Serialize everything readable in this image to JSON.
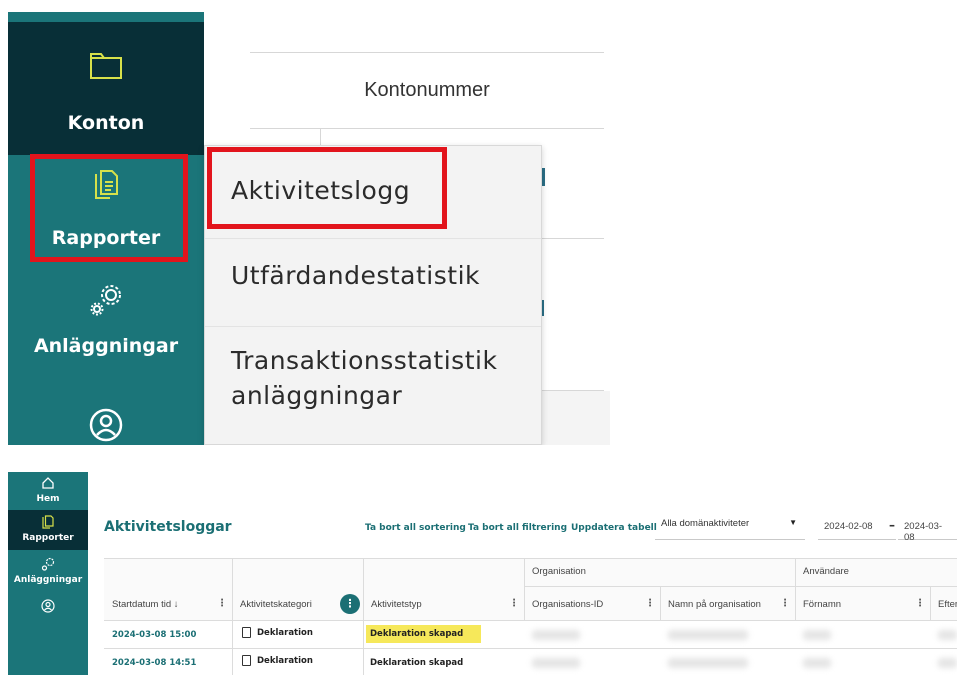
{
  "zoom": {
    "sidebar": {
      "konton_label": "Konton",
      "rapporter_label": "Rapporter",
      "anlaggningar_label": "Anläggningar"
    },
    "table": {
      "column_header": "Kontonummer"
    },
    "menu": {
      "items": [
        "Aktivitetslogg",
        "Utfärdandestatistik",
        "Transaktionsstatistik",
        "anläggningar"
      ]
    },
    "highlight_color": "#e2141c"
  },
  "app": {
    "sidebar": {
      "items": [
        {
          "label": "Hem",
          "icon": "home-icon"
        },
        {
          "label": "Rapporter",
          "icon": "report-icon"
        },
        {
          "label": "Anläggningar",
          "icon": "gears-icon"
        },
        {
          "label": "",
          "icon": "user-icon"
        }
      ]
    },
    "title": "Aktivitetsloggar",
    "links": {
      "remove_sort": "Ta bort all sortering",
      "remove_filter": "Ta bort all filtrering",
      "refresh": "Uppdatera tabell"
    },
    "filter": {
      "domain_select": "Alla domänaktiviteter",
      "date_from": "2024-02-08",
      "date_to": "2024-03-08"
    },
    "grid": {
      "group_headers": {
        "organisation": "Organisation",
        "users": "Användare"
      },
      "columns": {
        "start": "Startdatum tid ↓",
        "category": "Aktivitetskategori",
        "type": "Aktivitetstyp",
        "org_id": "Organisations-ID",
        "org_name": "Namn på organisation",
        "first_name": "Förnamn",
        "last_name": "Efter"
      },
      "rows": [
        {
          "start": "2024-03-08 15:00",
          "category": "Deklaration",
          "type": "Deklaration skapad",
          "highlighted": true
        },
        {
          "start": "2024-03-08 14:51",
          "category": "Deklaration",
          "type": "Deklaration skapad",
          "highlighted": false
        }
      ]
    },
    "colors": {
      "sidebar": "#1b7579",
      "sidebar_active": "#082f37",
      "accent": "#1b6f74",
      "icon": "#d7e14a",
      "row_highlight": "#f6e85a"
    }
  }
}
